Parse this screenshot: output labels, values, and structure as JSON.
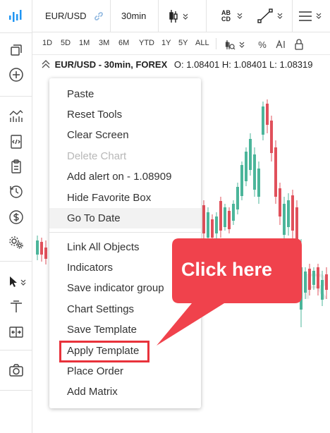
{
  "toolbar": {
    "symbol": "EUR/USD",
    "interval": "30min",
    "draw_abc": "AB",
    "draw_abc2": "CD"
  },
  "ranges": [
    "1D",
    "5D",
    "1M",
    "3M",
    "6M",
    "YTD",
    "1Y",
    "5Y",
    "ALL"
  ],
  "legend": {
    "title": "EUR/USD - 30min, FOREX",
    "ohl": "O: 1.08401 H: 1.08401 L: 1.08319"
  },
  "chart": {
    "watermark": "EUR/USD"
  },
  "menu": {
    "items": [
      {
        "label": "Paste"
      },
      {
        "label": "Reset Tools"
      },
      {
        "label": "Clear Screen"
      },
      {
        "label": "Delete Chart"
      },
      {
        "label": "Add alert on - 1.08909"
      },
      {
        "label": "Hide Favorite Box"
      },
      {
        "label": "Go To Date"
      },
      {
        "label": "Link All Objects"
      },
      {
        "label": "Indicators"
      },
      {
        "label": "Save indicator group"
      },
      {
        "label": "Chart Settings"
      },
      {
        "label": "Save Template"
      },
      {
        "label": "Apply Template"
      },
      {
        "label": "Place Order"
      },
      {
        "label": "Add Matrix"
      }
    ]
  },
  "callout": {
    "text": "Click here",
    "color": "#f0424c"
  },
  "colors": {
    "accent": "#2196f3",
    "up": "#4bb59a",
    "down": "#e0505b",
    "highlight": "#e8323b"
  }
}
